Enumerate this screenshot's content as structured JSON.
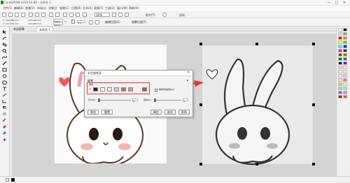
{
  "window": {
    "title": "CorelDRAW 2019 64-Bit - 未命名-1",
    "minimize": "—",
    "maximize": "□",
    "close": "✕"
  },
  "menu": [
    "文件(F)",
    "编辑(E)",
    "查看(V)",
    "布局(L)",
    "对象(J)",
    "效果(C)",
    "位图(B)",
    "文本(X)",
    "表格(T)",
    "工具(O)",
    "窗口(W)",
    "帮助(H)"
  ],
  "toolbar": {
    "zoom": "10%",
    "snap_label": "贴齐(T)",
    "launch_label": "启动"
  },
  "propbar": {
    "x": "X: 109.989 mm",
    "y": "Y: 132.478 mm",
    "w": "103.144 mm",
    "h": "102.486 mm",
    "sx": "100.0",
    "sy": "100.0",
    "unit": "%",
    "rotation": "0.0",
    "edit_bitmap": "编辑位图(E)",
    "trace_bitmap": "描摹位图(T)"
  },
  "tabs": {
    "welcome": "欢迎屏幕",
    "doc": "未命名-1"
  },
  "dialog": {
    "title": "彩色蜡笔画",
    "section": "蜡笔:",
    "colors_label": "颜色",
    "colors": [
      "#222222",
      "#ffffff",
      "#f4f4f4",
      "#cfcfcf",
      "#d06a3a",
      "#c9a27c",
      "#8a6a4a"
    ],
    "keep_label": "保留原始颜色(K)",
    "pressure_label": "压力(P):",
    "pressure_value": "0",
    "outline_label": "底纹(U):",
    "outline_value": "0",
    "preview": "预览",
    "reset": "重置",
    "ok": "确定",
    "cancel": "取消",
    "help": "帮助"
  },
  "status": "",
  "palette_colors": [
    "#ffffff",
    "#000000",
    "#e0e0e0",
    "#9e9e9e",
    "#ff0000",
    "#ff7f00",
    "#ffff00",
    "#00ff00",
    "#00ffff",
    "#0000ff",
    "#ff00ff",
    "#7f0000",
    "#7f3f00",
    "#7f7f00",
    "#007f00",
    "#007f7f",
    "#00007f",
    "#7f007f",
    "#ffcccc",
    "#ffe0b2",
    "#ffffcc",
    "#ccffcc",
    "#ccffff",
    "#ccccff",
    "#ffccff",
    "#ff6666",
    "#ffb266",
    "#ffff66",
    "#66ff66",
    "#66ffff",
    "#6666ff",
    "#ff66ff",
    "#cc0000",
    "#cc6600"
  ]
}
